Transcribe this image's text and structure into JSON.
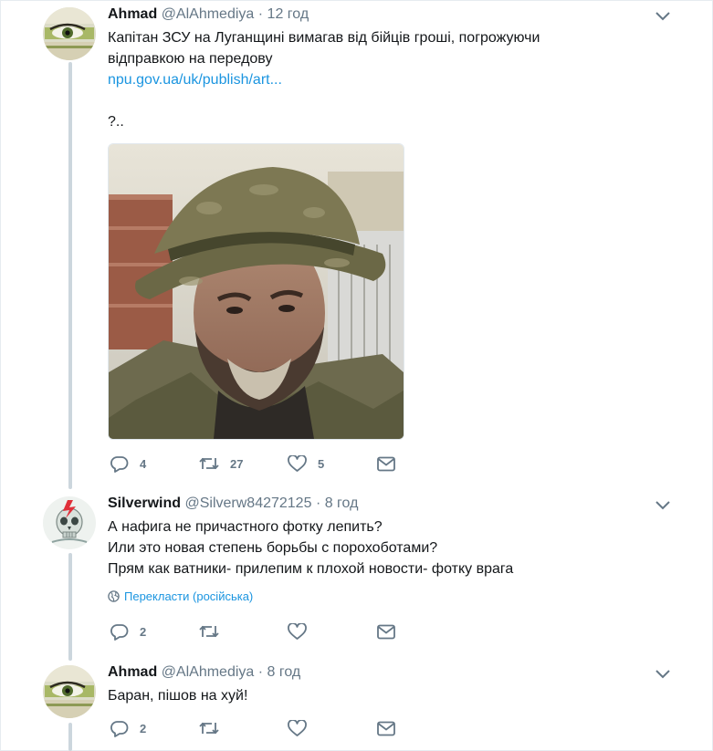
{
  "tweets": [
    {
      "name": "Ahmad",
      "handle": "@AlAhmediya",
      "time": "· 12 год",
      "text_line1": "Капітан ЗСУ на Луганщині вимагав від бійців гроші, погрожуючи",
      "text_line2": "відправкою на передову",
      "link": "npu.gov.ua/uk/publish/art...",
      "text_extra": "?..",
      "replies": "4",
      "retweets": "27",
      "likes": "5"
    },
    {
      "name": "Silverwind",
      "handle": "@Silverw84272125",
      "time": "· 8 год",
      "text_line1": "А нафига не причастного фотку лепить?",
      "text_line2": "Или это новая степень борьбы с порохоботами?",
      "text_line3": "Прям как ватники- прилепим к плохой новости- фотку врага",
      "translate": "Перекласти (російська)",
      "replies": "2",
      "retweets": "",
      "likes": ""
    },
    {
      "name": "Ahmad",
      "handle": "@AlAhmediya",
      "time": "· 8 год",
      "text_line1": "Баран, пішов на хуй!",
      "replies": "2",
      "retweets": "",
      "likes": ""
    }
  ],
  "icons": {
    "reply": "reply-icon",
    "retweet": "retweet-icon",
    "like": "heart-icon",
    "message": "envelope-icon",
    "caret": "chevron-down-icon",
    "globe": "globe-icon"
  },
  "colors": {
    "text": "#14171a",
    "secondary": "#657786",
    "link": "#1b95e0",
    "thread_line": "#ccd6dd"
  }
}
